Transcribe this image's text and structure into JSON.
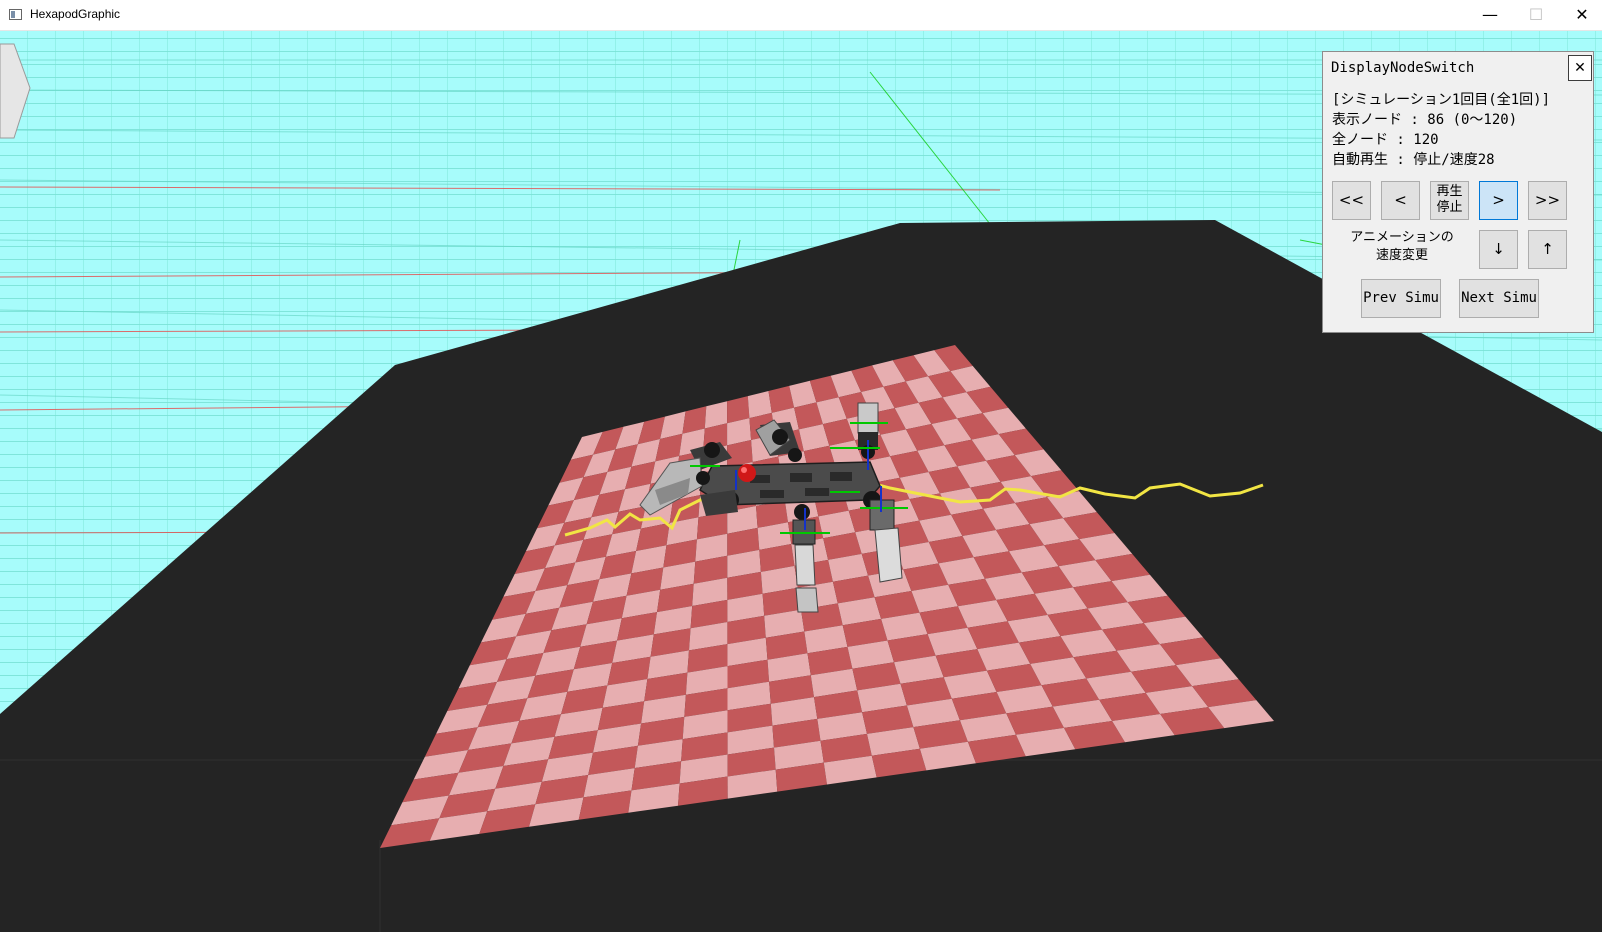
{
  "window": {
    "title": "HexapodGraphic",
    "minimize_glyph": "—",
    "maximize_glyph": "☐",
    "close_glyph": "✕"
  },
  "panel": {
    "title": "DisplayNodeSwitch",
    "close_glyph": "✕",
    "info_lines": [
      "[シミュレーション1回目(全1回)]",
      "表示ノード : 86 (0〜120)",
      "全ノード : 120",
      "自動再生 : 停止/速度28"
    ],
    "buttons": {
      "first": "<<",
      "prev": "<",
      "play_line1": "再生",
      "play_line2": "停止",
      "next": ">",
      "last": ">>"
    },
    "speed_label_line1": "アニメーションの",
    "speed_label_line2": "速度変更",
    "speed_down": "↓",
    "speed_up": "↑",
    "prev_simu": "Prev Simu",
    "next_simu": "Next Simu"
  },
  "display": {
    "current_node": 86,
    "total_nodes": 120
  },
  "colors": {
    "sky": "#a7fcfb",
    "grid_line": "#5fd2c0",
    "ground": "#242424",
    "checker_dark": "#c3585a",
    "checker_light": "#e7aeb0",
    "path": "#f1e544",
    "axis_red": "#ff0000",
    "axis_green": "#00c800",
    "button_selected": "#cce4f7"
  }
}
